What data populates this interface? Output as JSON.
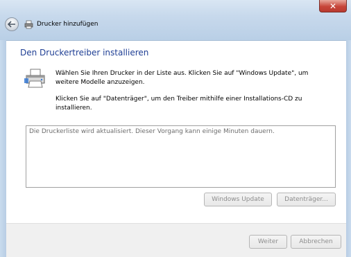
{
  "window": {
    "title": "Drucker hinzufügen",
    "close_label": "✕"
  },
  "page": {
    "heading": "Den Druckertreiber installieren",
    "description_1": "Wählen Sie Ihren Drucker in der Liste aus. Klicken Sie auf \"Windows Update\", um weitere Modelle anzuzeigen.",
    "description_2": "Klicken Sie auf \"Datenträger\", um den Treiber mithilfe einer Installations-CD zu installieren.",
    "list_status": "Die Druckerliste wird aktualisiert. Dieser Vorgang kann einige Minuten dauern."
  },
  "buttons": {
    "windows_update": "Windows Update",
    "datentraeger": "Datenträger...",
    "weiter": "Weiter",
    "abbrechen": "Abbrechen"
  },
  "colors": {
    "heading": "#1e3e94",
    "titlebar": "#c7d9ec",
    "disabled_text": "#8d8d8d"
  },
  "icons": [
    "back-arrow-icon",
    "printer-icon",
    "close-icon"
  ]
}
